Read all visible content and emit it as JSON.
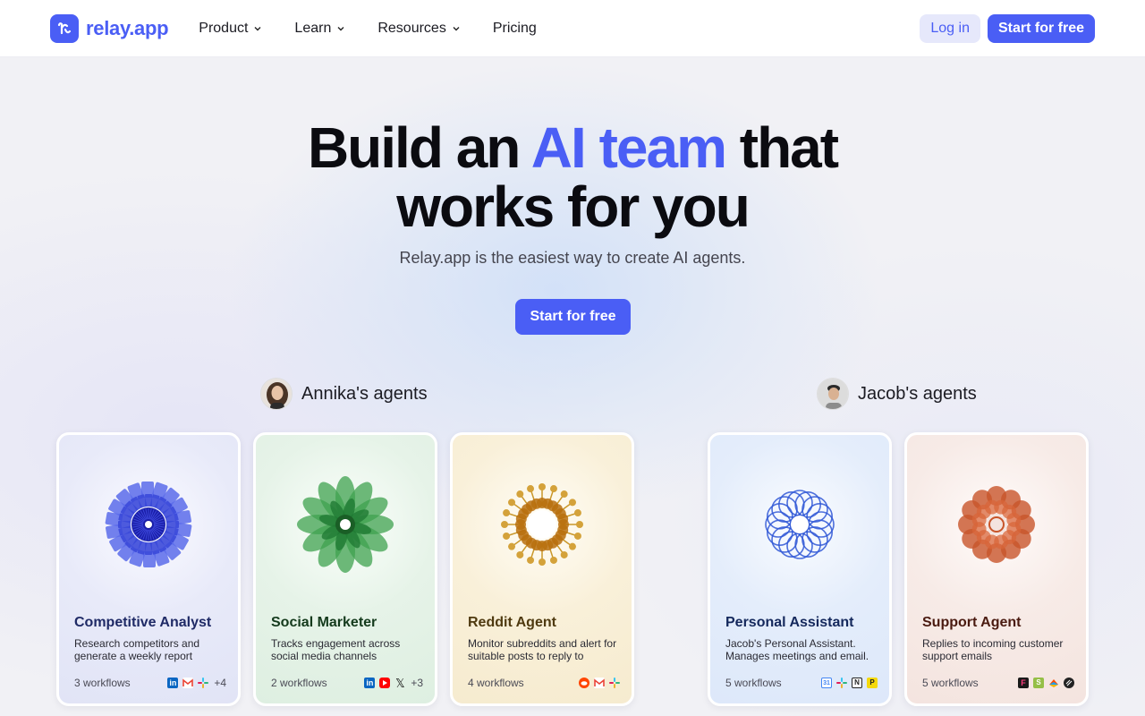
{
  "nav": {
    "logo_text": "relay.app",
    "links": [
      {
        "label": "Product",
        "dropdown": true
      },
      {
        "label": "Learn",
        "dropdown": true
      },
      {
        "label": "Resources",
        "dropdown": true
      },
      {
        "label": "Pricing",
        "dropdown": false
      }
    ],
    "login_label": "Log in",
    "start_label": "Start for free"
  },
  "hero": {
    "title_pre": "Build an ",
    "title_accent": "AI team",
    "title_post": " that",
    "title_line2": "works for you",
    "subtitle": "Relay.app is the easiest way to create AI agents.",
    "cta_label": "Start for free"
  },
  "owners": [
    {
      "label": "Annika's agents"
    },
    {
      "label": "Jacob's agents"
    }
  ],
  "cards": [
    {
      "name": "Competitive Analyst",
      "description": "Research competitors and generate a weekly report",
      "workflows": "3 workflows",
      "more": "+4",
      "apps": [
        "linkedin-icon",
        "gmail-icon",
        "slack-icon"
      ],
      "accent": "#1f2a66",
      "bg": "#e4e7f8"
    },
    {
      "name": "Social Marketer",
      "description": "Tracks engagement across social media channels",
      "workflows": "2 workflows",
      "more": "+3",
      "apps": [
        "linkedin-icon",
        "youtube-icon",
        "x-icon"
      ],
      "accent": "#143a1c",
      "bg": "#e2f1e4"
    },
    {
      "name": "Reddit Agent",
      "description": "Monitor subreddits and alert for suitable posts to reply to",
      "workflows": "4 workflows",
      "more": "",
      "apps": [
        "reddit-icon",
        "gmail-icon",
        "slack-icon"
      ],
      "accent": "#4f3a10",
      "bg": "#f8efd8"
    },
    {
      "name": "Personal Assistant",
      "description": "Jacob's Personal Assistant. Manages meetings and email.",
      "workflows": "5 workflows",
      "more": "",
      "apps": [
        "calendar-icon",
        "slack-icon",
        "notion-icon",
        "producthunt-icon"
      ],
      "accent": "#14285c",
      "bg": "#e1ebfb"
    },
    {
      "name": "Support Agent",
      "description": "Replies to incoming customer support emails",
      "workflows": "5 workflows",
      "more": "",
      "apps": [
        "front-icon",
        "shopify-icon",
        "zapier-icon",
        "linear-icon"
      ],
      "accent": "#4a1a10",
      "bg": "#f7e8e4"
    }
  ],
  "colors": {
    "brand": "#4a5ef5",
    "blue_art": "#3b49d9",
    "green_art": "#2f9a45",
    "gold_art": "#b8860b",
    "royal_art": "#2f57d6",
    "rust_art": "#c8552a"
  }
}
